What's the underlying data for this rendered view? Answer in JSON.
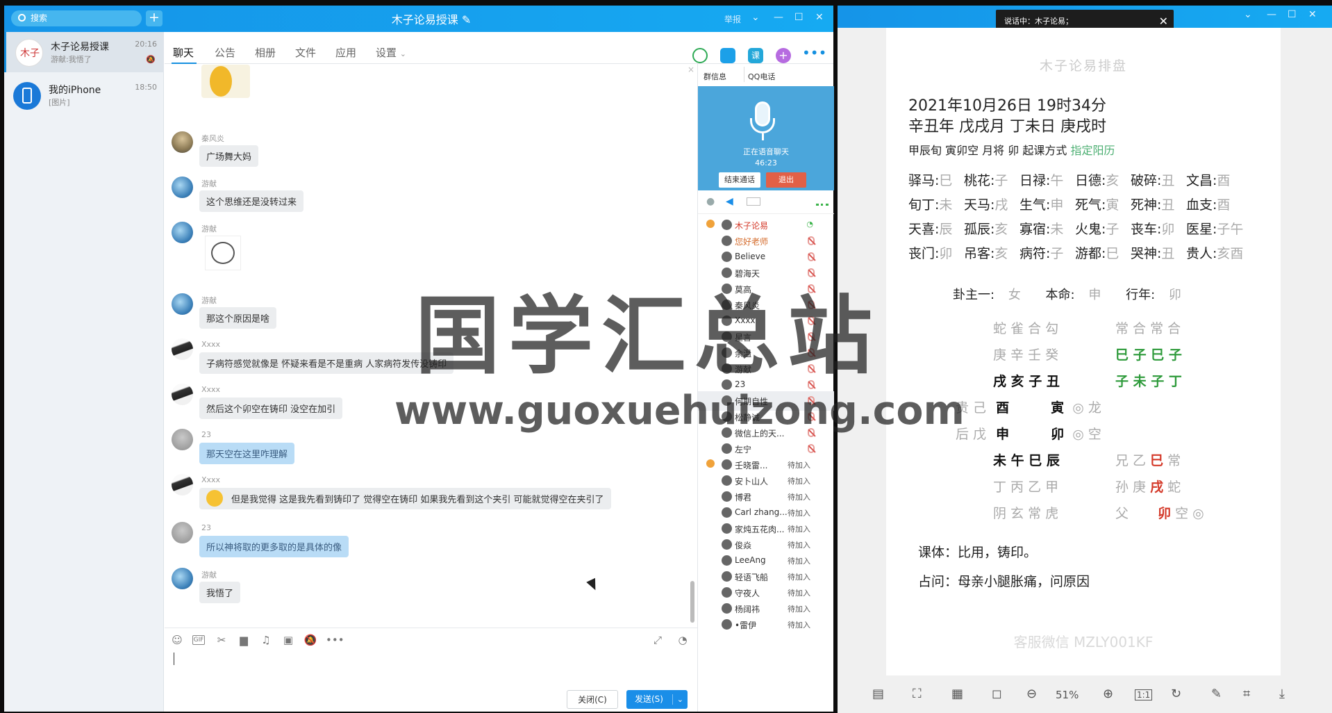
{
  "qq": {
    "search_placeholder": "搜索",
    "group_title": "木子论易授课",
    "title_report": "举报",
    "conversations": [
      {
        "name": "木子论易授课",
        "sub": "游献:我悟了",
        "time": "20:16"
      },
      {
        "name": "我的iPhone",
        "sub": "[图片]",
        "time": "18:50"
      }
    ],
    "tabs": [
      "聊天",
      "公告",
      "相册",
      "文件",
      "应用",
      "设置"
    ],
    "messages": [
      {
        "nick": "秦风炎",
        "text": "广场舞大妈",
        "style": "grey",
        "avatar": "buddha"
      },
      {
        "nick": "游献",
        "text": "这个思维还是没转过来",
        "style": "grey",
        "avatar": "earth"
      },
      {
        "nick": "游献",
        "text": "[图片]",
        "style": "sticker",
        "avatar": "earth"
      },
      {
        "nick": "游献",
        "text": "那这个原因是啥",
        "style": "grey",
        "avatar": "earth"
      },
      {
        "nick": "Xxxx",
        "text": "子病符感觉就像是 怀疑来看是不是重病 人家病符发传没铸印",
        "style": "grey",
        "avatar": "girl"
      },
      {
        "nick": "Xxxx",
        "text": "然后这个卯空在铸印 没空在加引",
        "style": "grey",
        "avatar": "girl"
      },
      {
        "nick": "23",
        "text": "那天空在这里咋理解",
        "style": "blue",
        "avatar": "grey"
      },
      {
        "nick": "Xxxx",
        "text": "但是我觉得 这是我先看到铸印了 觉得空在铸印  如果我先看到这个夹引 可能就觉得空在夹引了",
        "style": "grey",
        "avatar": "girl"
      },
      {
        "nick": "23",
        "text": "所以神将取的更多取的是具体的像",
        "style": "blue",
        "avatar": "grey"
      },
      {
        "nick": "游献",
        "text": "我悟了",
        "style": "grey",
        "avatar": "earth"
      }
    ],
    "btn_close": "关闭(C)",
    "btn_send": "发送(S)",
    "right_tabs": [
      "群信息",
      "QQ电话"
    ],
    "voice_status": "正在语音聊天",
    "voice_time": "46:23",
    "btn_end_call": "结束通话",
    "btn_exit": "退出",
    "members": [
      {
        "name": "木子论易",
        "status": "",
        "host": true
      },
      {
        "name": "您好老师",
        "status": ""
      },
      {
        "name": "Believe",
        "status": ""
      },
      {
        "name": "碧海天",
        "status": ""
      },
      {
        "name": "莫高",
        "status": ""
      },
      {
        "name": "秦风炎",
        "status": ""
      },
      {
        "name": "Xxxx",
        "status": ""
      },
      {
        "name": "星言",
        "status": ""
      },
      {
        "name": "余温",
        "status": ""
      },
      {
        "name": "游献",
        "status": ""
      },
      {
        "name": "23",
        "status": ""
      },
      {
        "name": "何期自性",
        "status": ""
      },
      {
        "name": "松静诚",
        "status": ""
      },
      {
        "name": "微信上的天...",
        "status": ""
      },
      {
        "name": "左宁",
        "status": ""
      },
      {
        "name": "壬晓雷...",
        "status": "待加入",
        "host": true
      },
      {
        "name": "安卜山人",
        "status": "待加入"
      },
      {
        "name": "博君",
        "status": "待加入"
      },
      {
        "name": "Carl zhang...",
        "status": "待加入"
      },
      {
        "name": "家炖五花肉...",
        "status": "待加入"
      },
      {
        "name": "俊焱",
        "status": "待加入"
      },
      {
        "name": "LeeAng",
        "status": "待加入"
      },
      {
        "name": "轻语飞船",
        "status": "待加入"
      },
      {
        "name": "守夜人",
        "status": "待加入"
      },
      {
        "name": "杨阔祎",
        "status": "待加入"
      },
      {
        "name": "•雷伊",
        "status": "待加入"
      }
    ]
  },
  "viewer": {
    "tooltip": "说话中：木子论易；",
    "page_title": "木子论易排盘",
    "date_line": "2021年10月26日 19时34分",
    "ganzhi_line": "辛丑年 戊戌月 丁未日 庚戌时",
    "xun_text": "甲辰旬 寅卯空 月将 卯 起课方式",
    "xun_link": "指定阳历",
    "shensha": [
      [
        [
          "驿马",
          "巳"
        ],
        [
          "桃花",
          "子"
        ],
        [
          "日禄",
          "午"
        ],
        [
          "日德",
          "亥"
        ],
        [
          "破碎",
          "丑"
        ],
        [
          "文昌",
          "酉"
        ]
      ],
      [
        [
          "旬丁",
          "未"
        ],
        [
          "天马",
          "戌"
        ],
        [
          "生气",
          "申"
        ],
        [
          "死气",
          "寅"
        ],
        [
          "死神",
          "丑"
        ],
        [
          "血支",
          "酉"
        ]
      ],
      [
        [
          "天喜",
          "辰"
        ],
        [
          "孤辰",
          "亥"
        ],
        [
          "寡宿",
          "未"
        ],
        [
          "火鬼",
          "子"
        ],
        [
          "丧车",
          "卯"
        ],
        [
          "医星",
          "子午"
        ]
      ],
      [
        [
          "丧门",
          "卯"
        ],
        [
          "吊客",
          "亥"
        ],
        [
          "病符",
          "子"
        ],
        [
          "游都",
          "巳"
        ],
        [
          "哭神",
          "丑"
        ],
        [
          "贵人",
          "亥酉"
        ]
      ]
    ],
    "guazhu_label": "卦主一:",
    "guazhu_val": "女",
    "benming_label": "本命:",
    "benming_val": "申",
    "xingnian_label": "行年:",
    "xingnian_val": "卯",
    "sike_shen": "蛇 雀 合 勾",
    "sike_top": "庚 辛 壬 癸",
    "sike_bottom": "戌 亥 子 丑",
    "sanchuan_shen": "常 合 常 合",
    "sanchuan_a": "巳 子 巳 子",
    "sanchuan_b": "子 未 子 丁",
    "tianpan_r1": {
      "pre": "贵 己",
      "a": "酉",
      "b": "寅",
      "post": "◎ 龙"
    },
    "tianpan_r2": {
      "pre": "后 戊",
      "a": "申",
      "b": "卯",
      "post": "◎ 空"
    },
    "dipan_r3": "未 午 巳 辰",
    "dipan_r4": "丁 丙 乙 甲",
    "dipan_r5": "阴 玄 常 虎",
    "chuan_1": {
      "pre": "兄 乙",
      "z": "巳",
      "post": "常"
    },
    "chuan_2": {
      "pre": "孙 庚",
      "z": "戌",
      "post": "蛇"
    },
    "chuan_3": {
      "pre": "父",
      "z": "卯",
      "post": "空 ◎"
    },
    "keti": "课体：比用，铸印。",
    "zhanwen": "占问：母亲小腿胀痛，问原因",
    "footer": "客服微信 MZLY001KF",
    "zoom": "51%"
  },
  "watermark": {
    "main": "国学汇总站",
    "url": "www.guoxuehuizong.com"
  },
  "colors": {
    "qq_blue": "#1594e8",
    "accent_green": "#4caf72",
    "red": "#d43a2a"
  }
}
